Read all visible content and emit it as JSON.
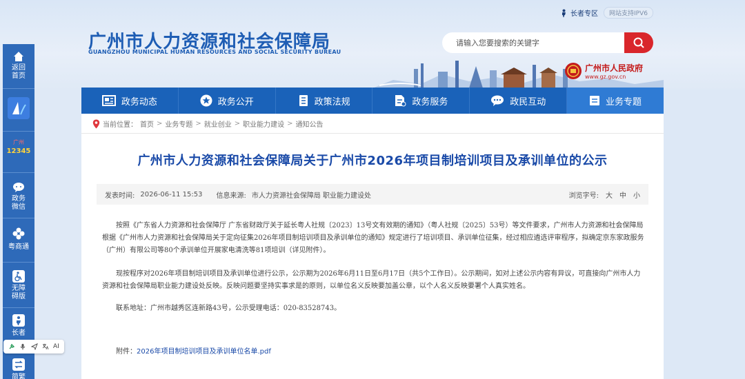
{
  "top": {
    "elder_zone": "长者专区",
    "ipv6": "网站支持IPV6"
  },
  "header": {
    "title": "广州市人力资源和社会保障局",
    "subtitle": "GUANGZHOU MUNICIPAL HUMAN RESOURCES AND SOCIAL SECURITY BUREAU",
    "gov_name": "广州市人民政府",
    "gov_url": "www.gz.gov.cn"
  },
  "search": {
    "placeholder": "请输入您要搜索的关键字"
  },
  "nav": {
    "items": [
      {
        "label": "政务动态",
        "icon": "news-icon"
      },
      {
        "label": "政务公开",
        "icon": "star-icon"
      },
      {
        "label": "政策法规",
        "icon": "book-icon"
      },
      {
        "label": "政务服务",
        "icon": "document-icon"
      },
      {
        "label": "政民互动",
        "icon": "chat-icon"
      },
      {
        "label": "业务专题",
        "icon": "list-icon"
      }
    ]
  },
  "sidebar": {
    "home": "返回首页",
    "wechat": "政务微信",
    "yueshang": "粤商通",
    "accessible": "无障碍版",
    "elder": "长者",
    "simplified": "简繁",
    "badge_12345": "12345",
    "badge_gz": "广州"
  },
  "breadcrumb": {
    "label": "当前位置：",
    "items": [
      "首页",
      "业务专题",
      "就业创业",
      "职业能力建设",
      "通知公告"
    ],
    "sep": ">"
  },
  "article": {
    "title": "广州市人力资源和社会保障局关于广州市2026年项目制培训项目及承训单位的公示",
    "publish_label": "发表时间:",
    "publish_time": "2026-06-11 15:53",
    "source_label": "信息来源:",
    "source": "市人力资源社会保障局 职业能力建设处",
    "font_label": "浏览字号:",
    "font_sizes": [
      "大",
      "中",
      "小"
    ],
    "paragraphs": [
      "按照《广东省人力资源和社会保障厅 广东省财政厅关于延长粤人社规〔2023〕13号文有效期的通知》（粤人社规〔2025〕53号）等文件要求，广州市人力资源和社会保障局根据《广州市人力资源和社会保障局关于定向征集2026年项目制培训项目及承训单位的通知》规定进行了培训项目、承训单位征集，经过相应遴选评审程序，拟确定京东家政服务（广州）有限公司等80个承训单位开展家电清洗等81项培训（详见附件）。",
      "现按程序对2026年项目制培训项目及承训单位进行公示，公示期为2026年6月11日至6月17日（共5个工作日）。公示期间，如对上述公示内容有异议，可直接向广州市人力资源和社会保障局职业能力建设处反映。反映问题要坚持实事求是的原则，以单位名义反映要加盖公章，以个人名义反映要署个人真实姓名。",
      "联系地址：广州市越秀区连新路43号，公示受理电话：020-83528743。"
    ],
    "attachment_label": "附件：",
    "attachment_name": "2026年项目制培训项目及承训单位名单.pdf"
  },
  "tools": {
    "ai": "AI"
  },
  "colors": {
    "nav_bg": "#1a62b9",
    "title_blue": "#1a4aa8",
    "search_red": "#d9262b",
    "gov_red": "#c41c1c"
  }
}
